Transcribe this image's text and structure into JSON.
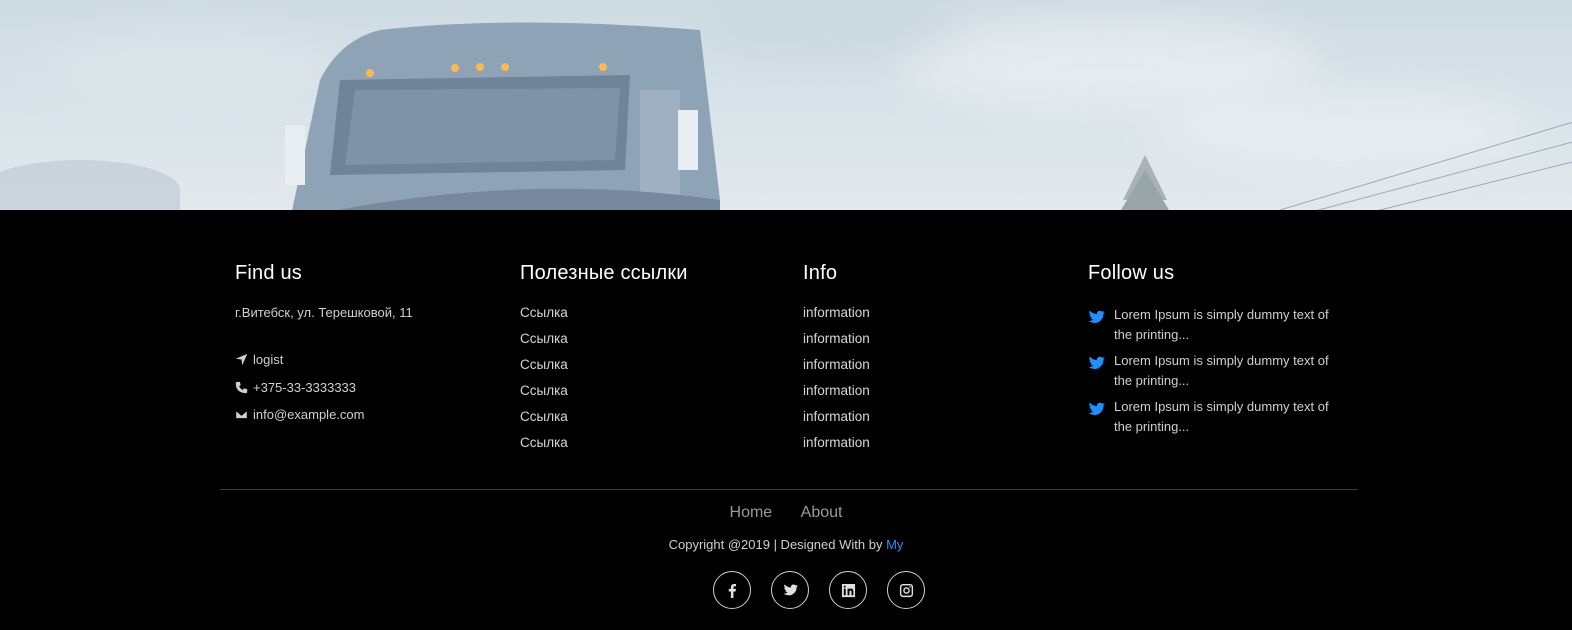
{
  "footer": {
    "find_us": {
      "title": "Find us",
      "address": "г.Витебск, ул. Терешковой, 11",
      "contacts": [
        {
          "icon": "location-arrow-icon",
          "text": "logist"
        },
        {
          "icon": "phone-icon",
          "text": "+375-33-3333333"
        },
        {
          "icon": "envelope-icon",
          "text": "info@example.com"
        }
      ]
    },
    "useful_links": {
      "title": "Полезные ссылки",
      "items": [
        "Ссылка",
        "Ссылка",
        "Ссылка",
        "Ссылка",
        "Ссылка",
        "Ссылка"
      ]
    },
    "info": {
      "title": "Info",
      "items": [
        "information",
        "information",
        "information",
        "information",
        "information",
        "information"
      ]
    },
    "follow_us": {
      "title": "Follow us",
      "tweets": [
        "Lorem Ipsum is simply dummy text of the printing...",
        "Lorem Ipsum is simply dummy text of the printing...",
        "Lorem Ipsum is simply dummy text of the printing..."
      ]
    },
    "nav": {
      "home": "Home",
      "about": "About"
    },
    "copyright": {
      "text": "Copyright @2019 | Designed With by ",
      "brand": "My"
    },
    "socials": [
      "facebook-icon",
      "twitter-icon",
      "linkedin-icon",
      "instagram-icon"
    ]
  },
  "colors": {
    "accent": "#1e90ff",
    "background": "#000000"
  }
}
